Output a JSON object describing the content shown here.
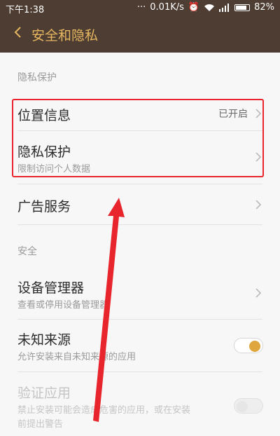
{
  "status_bar": {
    "time": "下午1:38",
    "speed": "0.01K/s",
    "battery": "82%"
  },
  "header": {
    "title": "安全和隐私",
    "back_icon": "chevron-left-icon"
  },
  "sections": {
    "privacy_label": "隐私保护",
    "security_label": "安全"
  },
  "items": {
    "location": {
      "title": "位置信息",
      "value": "已开启"
    },
    "privacy": {
      "title": "隐私保护",
      "subtitle": "限制访问个人数据"
    },
    "ads": {
      "title": "广告服务"
    },
    "device_admin": {
      "title": "设备管理器",
      "subtitle": "查看或停用设备管理器"
    },
    "unknown_sources": {
      "title": "未知来源",
      "subtitle": "允许安装来自未知来源的应用",
      "enabled": true
    },
    "verify_apps": {
      "title": "验证应用",
      "subtitle_line1": "禁止安装可能会造成危害的应用，或在安装",
      "subtitle_line2": "前提出警告",
      "enabled": false
    }
  },
  "colors": {
    "header_bg": "#4e3d33",
    "title_accent": "#e6b760",
    "toggle_on": "#e0a63e",
    "annotation_red": "#e8242c"
  }
}
